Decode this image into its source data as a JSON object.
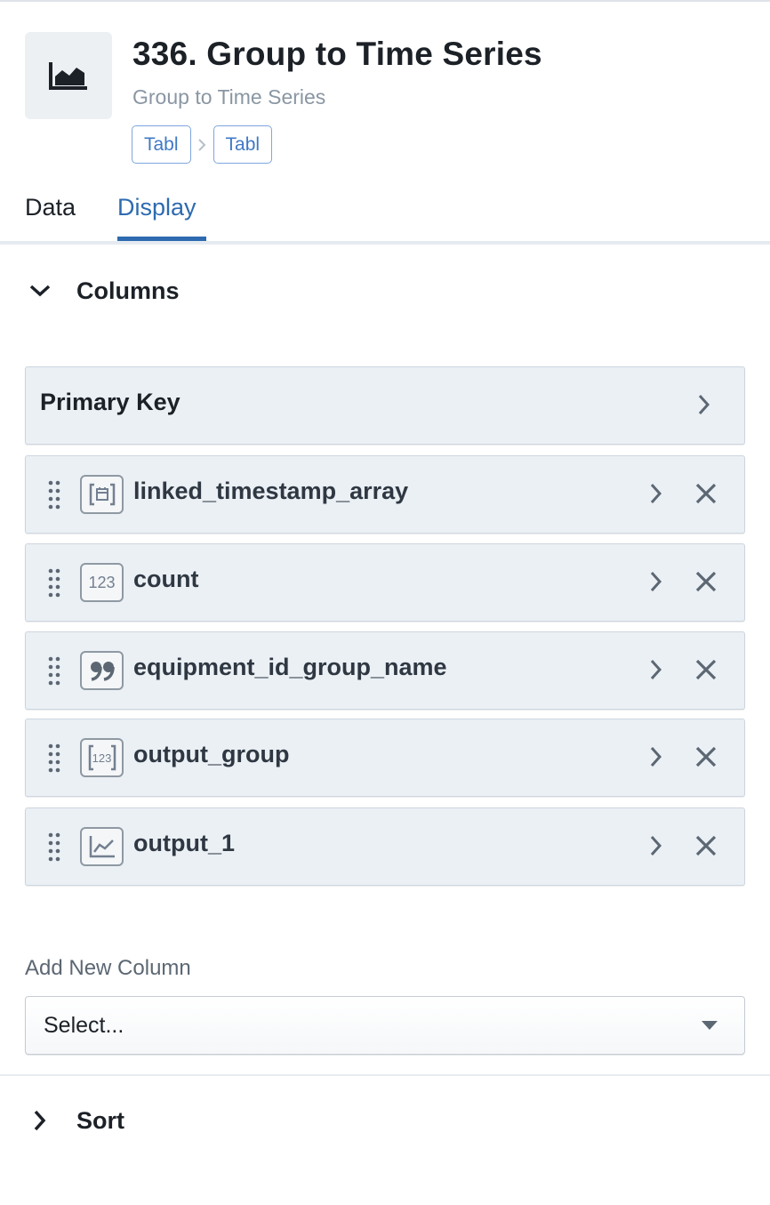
{
  "header": {
    "icon": "area-chart-icon",
    "title": "336. Group to Time Series",
    "subtitle": "Group to Time Series",
    "pills": [
      "Tabl",
      "Tabl"
    ]
  },
  "tabs": [
    {
      "label": "Data",
      "active": false
    },
    {
      "label": "Display",
      "active": true
    }
  ],
  "columns_section": {
    "label": "Columns",
    "expanded": true,
    "primary_key_label": "Primary Key",
    "columns": [
      {
        "name": "linked_timestamp_array",
        "type_icon": "timestamp-array-icon"
      },
      {
        "name": "count",
        "type_icon": "number-icon",
        "type_text": "123"
      },
      {
        "name": "equipment_id_group_name",
        "type_icon": "string-quote-icon"
      },
      {
        "name": "output_group",
        "type_icon": "number-array-icon",
        "type_text": "123"
      },
      {
        "name": "output_1",
        "type_icon": "time-series-icon"
      }
    ]
  },
  "add_column": {
    "label": "Add New Column",
    "select_value": "Select..."
  },
  "sort_section": {
    "label": "Sort",
    "expanded": false
  },
  "colors": {
    "accent": "#2d6ab0",
    "pill_border": "#7ea6e0",
    "row_bg": "#ebf0f5"
  }
}
